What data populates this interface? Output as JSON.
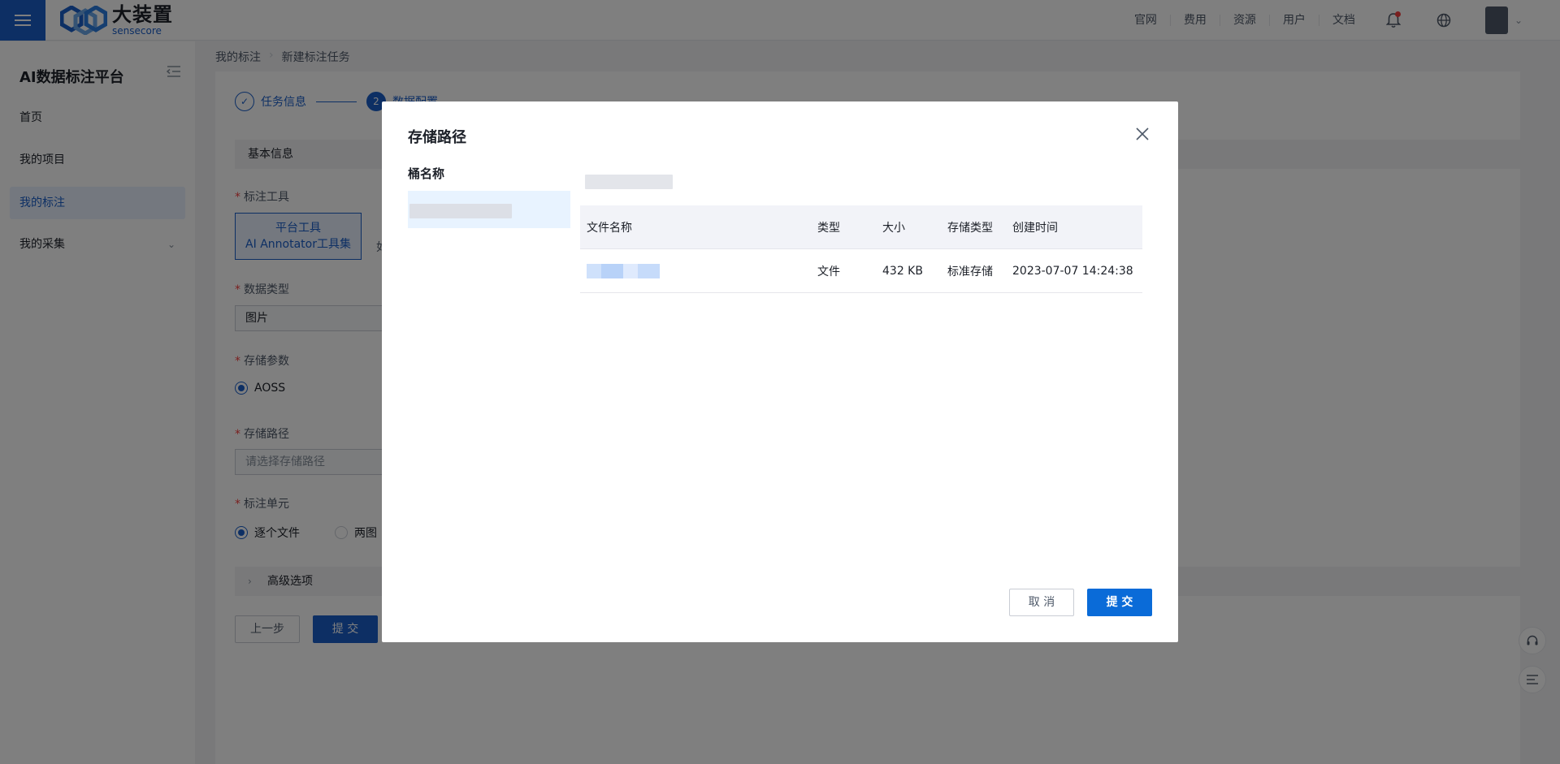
{
  "header": {
    "logo_cn": "大装置",
    "logo_en": "sensecore",
    "links": [
      "官网",
      "费用",
      "资源",
      "用户",
      "文档"
    ]
  },
  "sidebar": {
    "title": "AI数据标注平台",
    "items": [
      {
        "label": "首页"
      },
      {
        "label": "我的项目"
      },
      {
        "label": "我的标注"
      },
      {
        "label": "我的采集"
      }
    ]
  },
  "breadcrumb": [
    "我的标注",
    "新建标注任务"
  ],
  "steps": [
    {
      "num": "✓",
      "label": "任务信息"
    },
    {
      "num": "2",
      "label": "数据配置"
    }
  ],
  "form": {
    "section_basic": "基本信息",
    "tool_label": "标注工具",
    "tool_card_line1": "平台工具",
    "tool_card_line2": "AI Annotator工具集",
    "tool_other_partial": "如",
    "data_type_label": "数据类型",
    "data_type_value": "图片",
    "storage_param_label": "存储参数",
    "storage_option": "AOSS",
    "storage_path_label": "存储路径",
    "storage_path_placeholder": "请选择存储路径",
    "unit_label": "标注单元",
    "unit_option1": "逐个文件",
    "unit_option2": "两图",
    "advanced": "高级选项",
    "prev_button": "上一步",
    "submit_button": "提 交"
  },
  "modal": {
    "title": "存储路径",
    "bucket_label": "桶名称",
    "columns": [
      "文件名称",
      "类型",
      "大小",
      "存储类型",
      "创建时间"
    ],
    "rows": [
      {
        "type": "文件",
        "size": "432 KB",
        "storage_type": "标准存储",
        "created": "2023-07-07 14:24:38"
      }
    ],
    "cancel_button": "取 消",
    "submit_button": "提 交"
  },
  "colors": {
    "primary": "#1a5fc9",
    "overlay": "rgba(0,0,0,0.5)"
  }
}
